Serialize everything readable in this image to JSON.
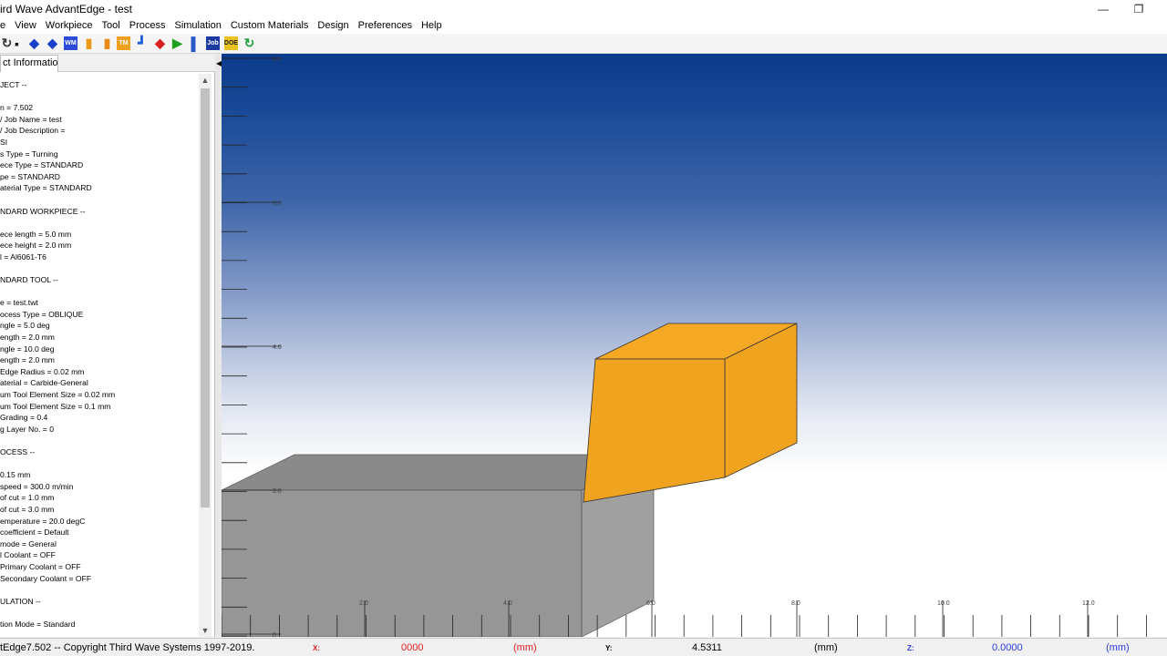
{
  "app": {
    "title": "ird Wave AdvantEdge - test"
  },
  "window_controls": {
    "minimize": "—",
    "restore": "❐"
  },
  "menu": [
    "e",
    "View",
    "Workpiece",
    "Tool",
    "Process",
    "Simulation",
    "Custom Materials",
    "Design",
    "Preferences",
    "Help"
  ],
  "toolbar": {
    "icons": [
      {
        "name": "open-icon",
        "glyph": "↻",
        "color": "#3a3a3a"
      },
      {
        "name": "save-icon",
        "glyph": "▪",
        "color": "#1a1a1a"
      },
      {
        "name": "workpiece-view-icon",
        "glyph": "◆",
        "color": "#1840c8"
      },
      {
        "name": "tool-view-icon",
        "glyph": "◆",
        "color": "#1840c8"
      },
      {
        "name": "workpiece-material-icon",
        "glyph": "WM",
        "color": "#2b4bd8"
      },
      {
        "name": "tool-icon",
        "glyph": "▮",
        "color": "#e89a18"
      },
      {
        "name": "tool-edge-icon",
        "glyph": "▮",
        "color": "#e88a18"
      },
      {
        "name": "tool-material-icon",
        "glyph": "TM",
        "color": "#f0a020"
      },
      {
        "name": "process-icon",
        "glyph": "┛",
        "color": "#1a5ad8"
      },
      {
        "name": "simulation-icon",
        "glyph": "◆",
        "color": "#d82020"
      },
      {
        "name": "run-icon",
        "glyph": "▶",
        "color": "#20a020"
      },
      {
        "name": "results-icon",
        "glyph": "▌",
        "color": "#2b58c8"
      },
      {
        "name": "job-icon",
        "glyph": "Job",
        "color": "#1a3aa0"
      },
      {
        "name": "doe-icon",
        "glyph": "DOE",
        "color": "#e8c020"
      },
      {
        "name": "refresh-icon",
        "glyph": "↻",
        "color": "#20a040"
      }
    ]
  },
  "panel": {
    "tab_label": "ct Information",
    "lines": [
      "JECT --",
      "",
      "n = 7.502",
      "/ Job Name  = test",
      "/ Job Description  =",
      "SI",
      "s Type = Turning",
      "ece Type = STANDARD",
      "pe = STANDARD",
      "aterial Type = STANDARD",
      "",
      "NDARD WORKPIECE --",
      "",
      "ece length = 5.0 mm",
      "ece height = 2.0 mm",
      "l = Al6061-T6",
      "",
      "NDARD TOOL --",
      "",
      "e = test.twt",
      "ocess Type = OBLIQUE",
      "ngle = 5.0 deg",
      "ength = 2.0 mm",
      "ngle = 10.0 deg",
      "ength = 2.0 mm",
      " Edge Radius = 0.02 mm",
      "aterial = Carbide-General",
      "um Tool Element Size = 0.02 mm",
      "um Tool Element Size = 0.1 mm",
      "Grading = 0.4",
      "g Layer No. = 0",
      "",
      "OCESS --",
      "",
      "0.15 mm",
      " speed = 300.0 m/min",
      "of cut = 1.0 mm",
      "of cut = 3.0 mm",
      "emperature = 20.0 degC",
      " coefficient = Default",
      " mode = General",
      "l Coolant = OFF",
      " Primary Coolant = OFF",
      " Secondary Coolant = OFF",
      "",
      "ULATION --",
      "",
      "tion Mode = Standard"
    ]
  },
  "viewport": {
    "y_ticks": [
      "8.0",
      "6.0",
      "4.0",
      "2.0",
      "0"
    ],
    "x_ticks": [
      "2.0",
      "4.0",
      "6.0",
      "8.0",
      "10.0",
      "12.0"
    ],
    "colors": {
      "tool": "#f0a31e",
      "workpiece": "#969696",
      "sky_top": "#0a3a8a"
    }
  },
  "status": {
    "copyright": "tEdge7.502 -- Copyright Third Wave Systems 1997-2019.",
    "x_label": "X:",
    "x_value": "0000",
    "x_unit": "(mm)",
    "y_label": "Y:",
    "y_value": "4.5311",
    "y_unit": "(mm)",
    "z_label": "Z:",
    "z_value": "0.0000",
    "z_unit": "(mm)"
  }
}
